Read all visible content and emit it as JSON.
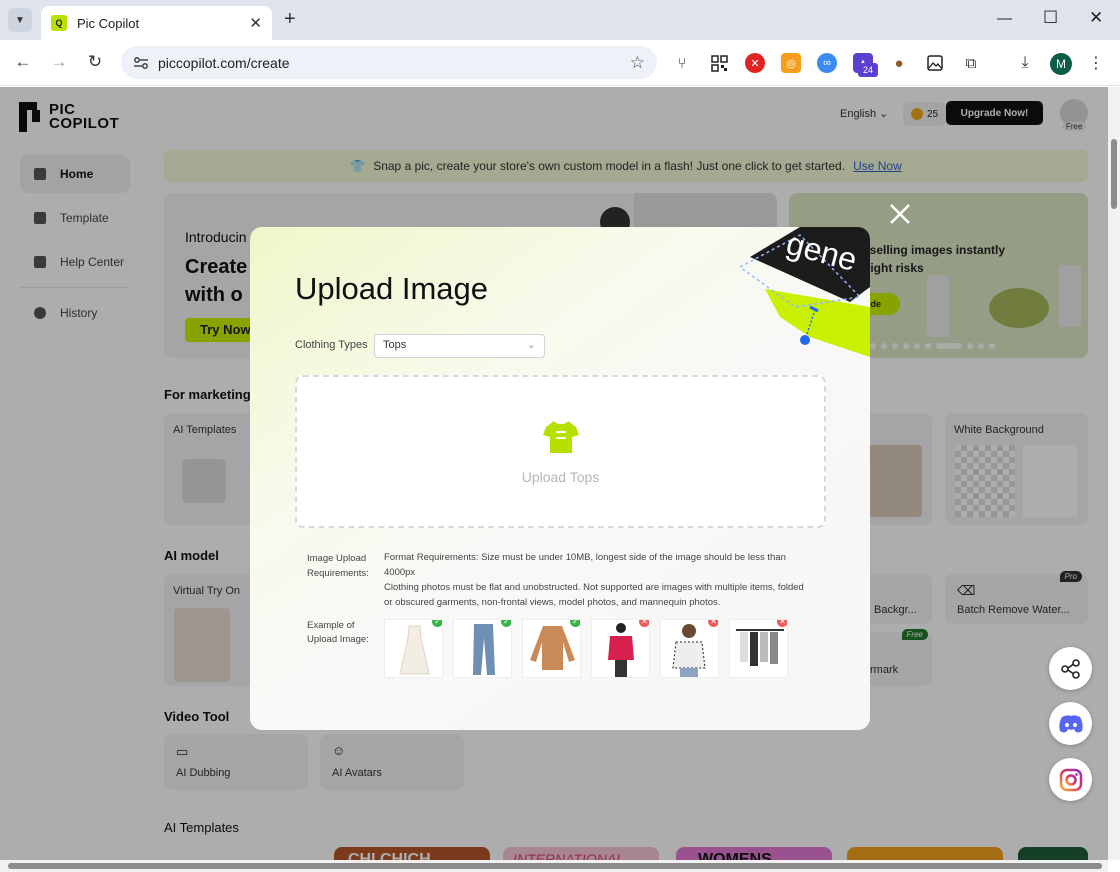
{
  "browser": {
    "tab_title": "Pic Copilot",
    "url": "piccopilot.com/create",
    "profile_initial": "M",
    "ext_badge_count": "24"
  },
  "header": {
    "logo_line1": "PIC",
    "logo_line2": "COPILOT",
    "language": "English",
    "coins": "25",
    "upgrade_label": "Upgrade Now!",
    "plan_badge": "Free"
  },
  "sidebar": {
    "items": [
      {
        "label": "Home"
      },
      {
        "label": "Template"
      },
      {
        "label": "Help Center"
      },
      {
        "label": "History"
      }
    ]
  },
  "announcement": {
    "text": "Snap a pic, create your store's own custom model in a flash! Just one click to get started.",
    "link": "Use Now"
  },
  "hero": {
    "left_intro": "Introducin",
    "left_headline_1": "Create",
    "left_headline_2": "with o",
    "left_button": "Try Now",
    "right_line_1": "stselling images instantly",
    "right_line_2": "yright risks",
    "right_button": "ide"
  },
  "sections": {
    "marketing": "For marketing",
    "ai_model": "AI model",
    "video_tool": "Video Tool",
    "ai_templates": "AI Templates"
  },
  "cards": {
    "ai_templates": "AI Templates",
    "white_background": "White Background",
    "virtual_try_on": "Virtual Try On",
    "remove_background": "Backgr...",
    "batch_remove_water": "Batch Remove Water...",
    "watermark": "rmark",
    "ai_dubbing": "AI Dubbing",
    "ai_avatars": "AI Avatars",
    "pro_badge": "Pro",
    "free_badge": "Free"
  },
  "templates_strip": [
    "CHI CHICH",
    "INTERNATIONAL",
    "WOMENS"
  ],
  "modal": {
    "title": "Upload Image",
    "decor_text": "gene",
    "clothing_types_label": "Clothing Types",
    "clothing_type_value": "Tops",
    "upload_label": "Upload Tops",
    "requirements_label": "Image Upload Requirements:",
    "requirements_line_1": "Format Requirements: Size must be under 10MB, longest side of the image should be less than 4000px",
    "requirements_line_2": "Clothing photos must be flat and unobstructed. Not supported are images with multiple items, folded or obscured garments, non-frontal views, model photos, and mannequin photos.",
    "example_label": "Example of Upload Image:",
    "examples": [
      {
        "name": "white dress",
        "ok": true
      },
      {
        "name": "blue jeans",
        "ok": true
      },
      {
        "name": "brown sweater",
        "ok": true
      },
      {
        "name": "mannequin top",
        "ok": false
      },
      {
        "name": "model photo",
        "ok": false
      },
      {
        "name": "clothes rack",
        "ok": false
      }
    ]
  },
  "colors": {
    "accent": "#c6f000",
    "ok": "#3bb34a",
    "bad": "#ef5a5a"
  },
  "floating": [
    "share-icon",
    "discord-icon",
    "instagram-icon"
  ]
}
